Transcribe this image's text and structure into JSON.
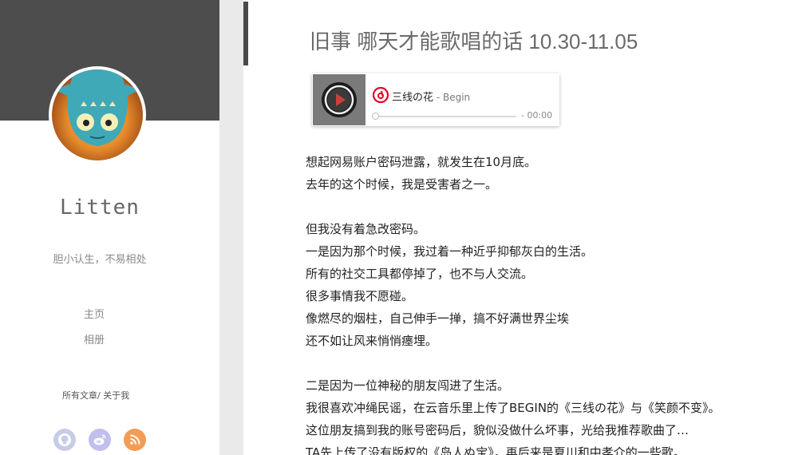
{
  "sidebar": {
    "site_name": "Litten",
    "tagline": "胆小认生，不易相处",
    "nav": [
      {
        "label": "主页"
      },
      {
        "label": "相册"
      }
    ],
    "links": {
      "all_posts": "所有文章",
      "separator": "/",
      "about": "关于我"
    },
    "social": [
      {
        "icon": "github-icon",
        "color": "#c8cde6"
      },
      {
        "icon": "weibo-icon",
        "color": "#c0bfee"
      },
      {
        "icon": "rss-icon",
        "color": "#f39c55"
      }
    ],
    "header_color": "#4d4d4d"
  },
  "post": {
    "title": "旧事 哪天才能歌唱的话 10.30-11.05",
    "player": {
      "song_title": "三线の花",
      "artist": " - Begin",
      "time": "- 00:00",
      "brand_color": "#e60026"
    },
    "paragraphs": [
      [
        "想起网易账户密码泄露，就发生在10月底。",
        "去年的这个时候，我是受害者之一。"
      ],
      [
        "但我没有着急改密码。",
        "一是因为那个时候，我过着一种近乎抑郁灰白的生活。",
        "所有的社交工具都停掉了，也不与人交流。",
        "很多事情我不愿碰。",
        "像燃尽的烟柱，自己伸手一掸，搞不好满世界尘埃",
        "还不如让风来悄悄瘗埋。"
      ],
      [
        "二是因为一位神秘的朋友闯进了生活。",
        "我很喜欢冲绳民谣，在云音乐里上传了BEGIN的《三线の花》与《笑颜不变》。",
        "这位朋友搞到我的账号密码后，貌似没做什么坏事，光给我推荐歌曲了…",
        "TA先上传了没有版权的《岛人ぬ宝》，再后来是夏川和中孝介的一些歌。"
      ]
    ]
  }
}
